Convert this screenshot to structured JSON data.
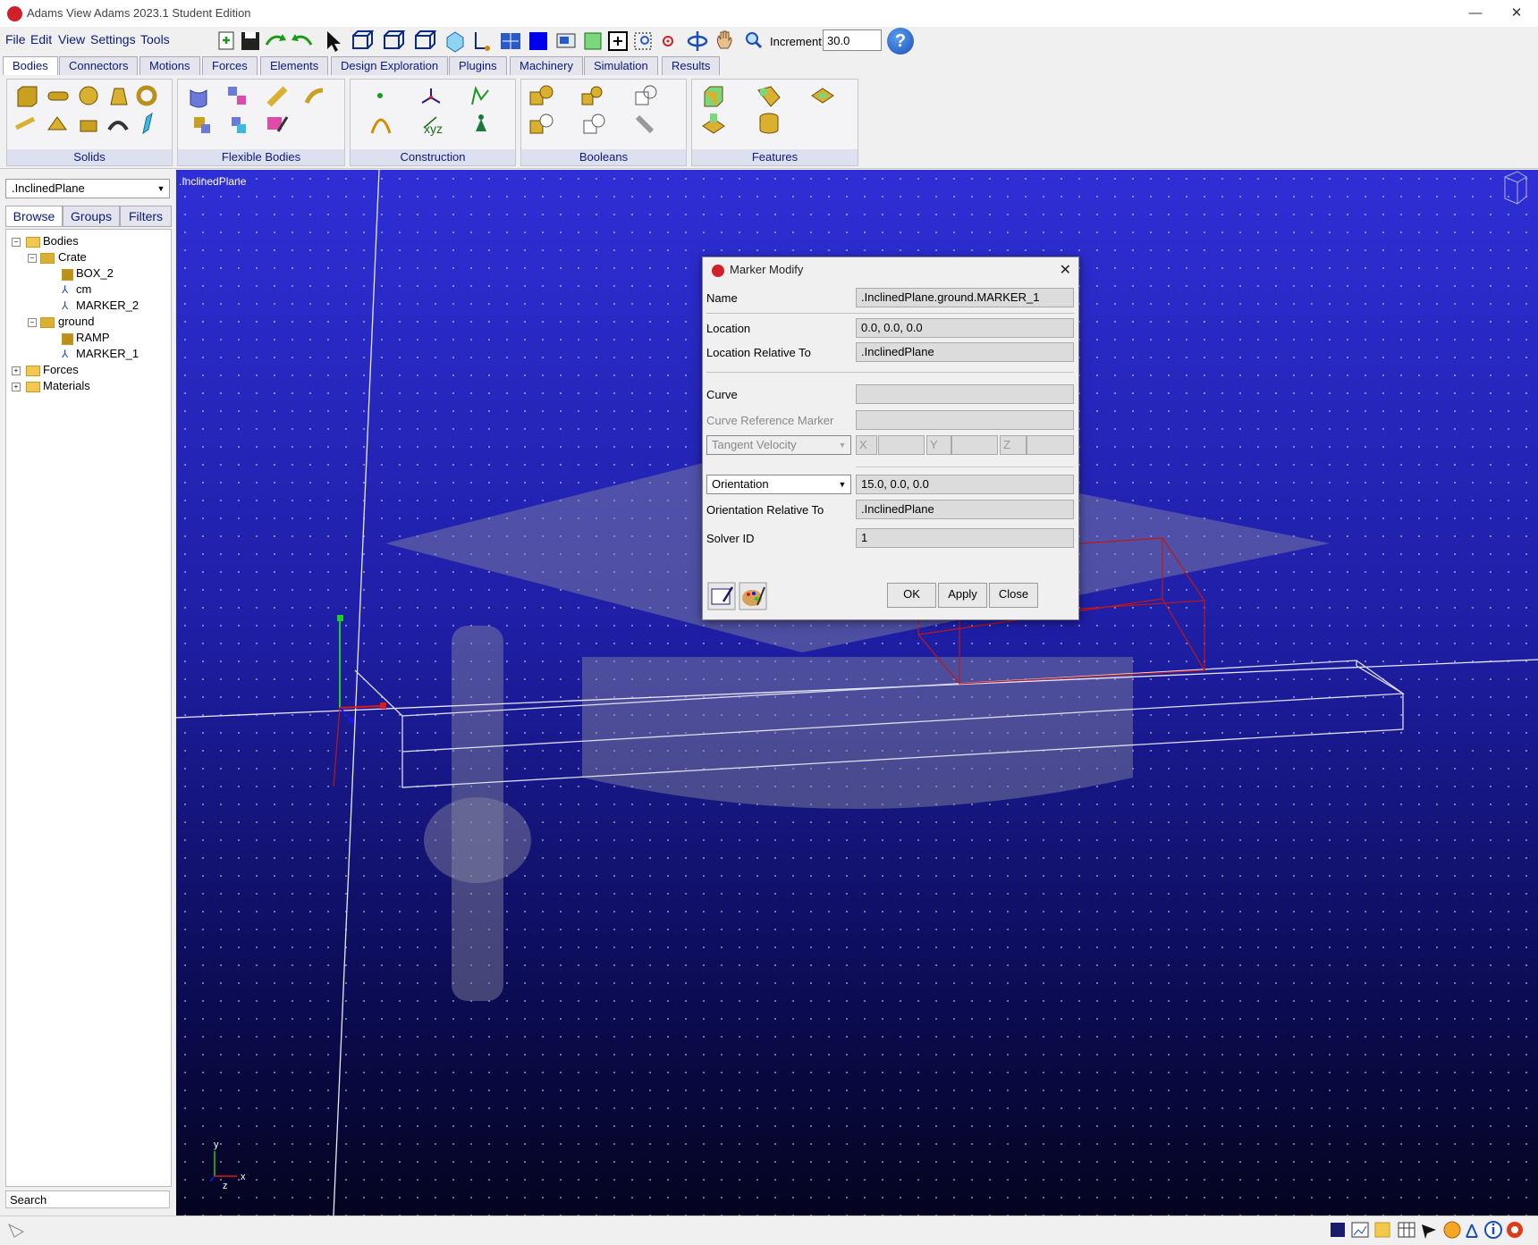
{
  "window": {
    "title": "Adams  View Adams 2023.1 Student Edition",
    "minimize": "—",
    "maximize": "☐",
    "close": "✕"
  },
  "menu": [
    "File",
    "Edit",
    "View",
    "Settings",
    "Tools"
  ],
  "toolbar": {
    "increment_label": "Increment",
    "increment_value": "30.0",
    "help": "?"
  },
  "ribbon_tabs": [
    "Bodies",
    "Connectors",
    "Motions",
    "Forces",
    "Elements",
    "Design Exploration",
    "Plugins",
    "Machinery",
    "Simulation",
    "Results"
  ],
  "ribbon_groups": {
    "solids": "Solids",
    "flexible": "Flexible Bodies",
    "construction": "Construction",
    "booleans": "Booleans",
    "features": "Features",
    "construction_xyz": "xyz"
  },
  "left_panel": {
    "model": ".InclinedPlane",
    "tabs": [
      "Browse",
      "Groups",
      "Filters"
    ],
    "tree": [
      "Bodies",
      "Crate",
      "BOX_2",
      "cm",
      "MARKER_2",
      "ground",
      "RAMP",
      "MARKER_1",
      "Forces",
      "Materials"
    ],
    "search": "Search"
  },
  "viewport": {
    "label": ".InclinedPlane",
    "axis_y": "y",
    "axis_x": "x",
    "axis_z": "z"
  },
  "dialog": {
    "title": "Marker Modify",
    "name_label": "Name",
    "name_value": ".InclinedPlane.ground.MARKER_1",
    "location_label": "Location",
    "location_value": "0.0, 0.0, 0.0",
    "loc_rel_label": "Location Relative To",
    "loc_rel_value": ".InclinedPlane",
    "curve_label": "Curve",
    "curve_ref_label": "Curve Reference Marker",
    "tangent_select": "Tangent Velocity",
    "x_label": "X",
    "y_label": "Y",
    "z_label": "Z",
    "orientation_select": "Orientation",
    "orientation_value": "15.0, 0.0, 0.0",
    "orient_rel_label": "Orientation Relative To",
    "orient_rel_value": ".InclinedPlane",
    "solver_label": "Solver ID",
    "solver_value": "1",
    "ok": "OK",
    "apply": "Apply",
    "close": "Close"
  },
  "colors": {
    "accent_blue": "#0a1a80",
    "viewport_top": "#2e2fd6",
    "viewport_bottom": "#04041f",
    "adams_red": "#d0202a"
  }
}
